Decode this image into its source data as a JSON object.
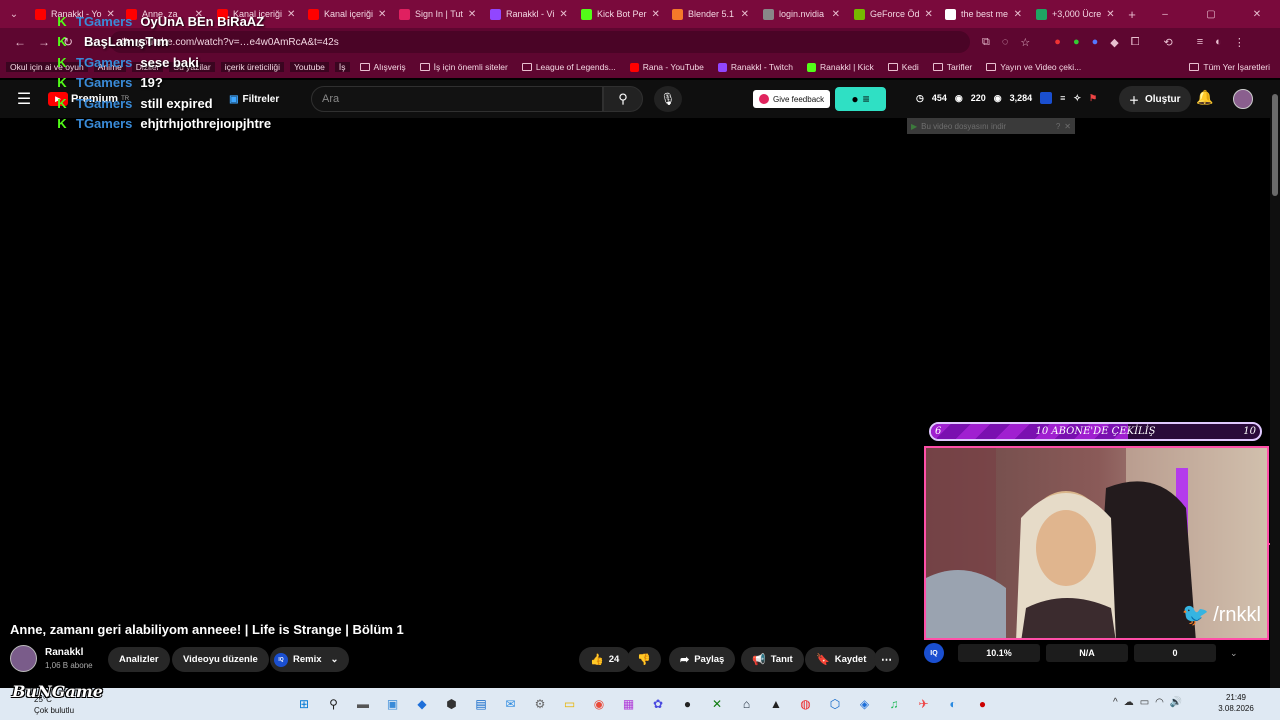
{
  "browser": {
    "tabs": [
      {
        "title": "Ranakkl - Yo",
        "color": "#ff0000"
      },
      {
        "title": "Anne, za",
        "color": "#ff0000"
      },
      {
        "title": "Kanal içeriği",
        "color": "#ff0000"
      },
      {
        "title": "Kanal içeriği",
        "color": "#ff0000"
      },
      {
        "title": "Sign In | Tut",
        "color": "#e02060"
      },
      {
        "title": "Ranakkl - Vi",
        "color": "#9146ff"
      },
      {
        "title": "Kick Bot Per",
        "color": "#53fc18"
      },
      {
        "title": "Blender 5.1",
        "color": "#f5792a"
      },
      {
        "title": "login.nvidia",
        "color": "#888888"
      },
      {
        "title": "GeForce Öd",
        "color": "#76b900"
      },
      {
        "title": "the best me",
        "color": "#ffffff"
      },
      {
        "title": "+3,000 Ücre",
        "color": "#1fa463"
      }
    ],
    "url": "youtube.com/watch?v=…e4w0AmRcA&t=42s",
    "bookmarks": [
      {
        "label": "Okul için ai ve oyun",
        "kind": "dark"
      },
      {
        "label": "Anime",
        "kind": "dark"
      },
      {
        "label": "Diziler",
        "kind": "dark"
      },
      {
        "label": "Su yazilar",
        "kind": "dark"
      },
      {
        "label": "içerik üreticiliği",
        "kind": "dark"
      },
      {
        "label": "Youtube",
        "kind": "dark"
      },
      {
        "label": "İş",
        "kind": "dark"
      },
      {
        "label": "Alışveriş",
        "kind": "folder"
      },
      {
        "label": "İş için önemli siteler",
        "kind": "folder"
      },
      {
        "label": "League of Legends...",
        "kind": "folder"
      },
      {
        "label": "Rana - YouTube",
        "kind": "yt"
      },
      {
        "label": "Ranakkl - Twitch",
        "kind": "twitch"
      },
      {
        "label": "Ranakkl | Kick",
        "kind": "kick"
      },
      {
        "label": "Kedi",
        "kind": "folder"
      },
      {
        "label": "Tarifler",
        "kind": "folder"
      },
      {
        "label": "Yayın ve Video çeki...",
        "kind": "folder"
      }
    ],
    "all_bookmarks": "Tüm Yer İşaretleri"
  },
  "youtube": {
    "premium": "Premium",
    "premium_sup": "TR",
    "filters": "Filtreler",
    "search_placeholder": "Ara",
    "feedback": "Give feedback",
    "stats": {
      "a": "454",
      "b": "220",
      "c": "3,284"
    },
    "create": "Oluştur",
    "download_banner": "Bu video dosyasını indir",
    "video_title": "Anne, zamanı geri alabiliyom anneee! | Life is Strange | Bölüm 1",
    "channel_name": "Ranakkl",
    "subscribers": "1,06 B abone",
    "buttons": {
      "analytics": "Analizler",
      "edit": "Videoyu düzenle",
      "remix": "Remix",
      "likes": "24",
      "share": "Paylaş",
      "promote": "Tanıt",
      "save": "Kaydet"
    }
  },
  "chat": [
    {
      "user": "TGamers",
      "message": "OyUnA BEn BiRaAZ"
    },
    {
      "user": "",
      "message": "BaşLamışTım"
    },
    {
      "user": "TGamers",
      "message": "sese baki"
    },
    {
      "user": "TGamers",
      "message": "19?"
    },
    {
      "user": "TGamers",
      "message": "still expired"
    },
    {
      "user": "TGamers",
      "message": "ehjtrhıjothrejıoıpjhtre"
    }
  ],
  "overlay": {
    "goal_title": "10 ABONE'DE ÇEKİLİŞ",
    "goal_current": "6",
    "goal_max": "10",
    "goal_progress": 0.6,
    "twitter": "/rnkkl",
    "ext_logo": "IQ",
    "ext_percent": "10.1%",
    "ext_na": "N/A",
    "ext_zero": "0"
  },
  "taskbar": {
    "brand": "BuNGame",
    "temp": "25°C",
    "condition": "Çok bulutlu",
    "time": "21:49",
    "date": "3.08.2026"
  },
  "colors": {
    "tabbar": "#7a0a3c",
    "accent_pink": "#ff4fa8",
    "kick_green": "#53fc18",
    "chat_user": "#3a8bd8"
  }
}
